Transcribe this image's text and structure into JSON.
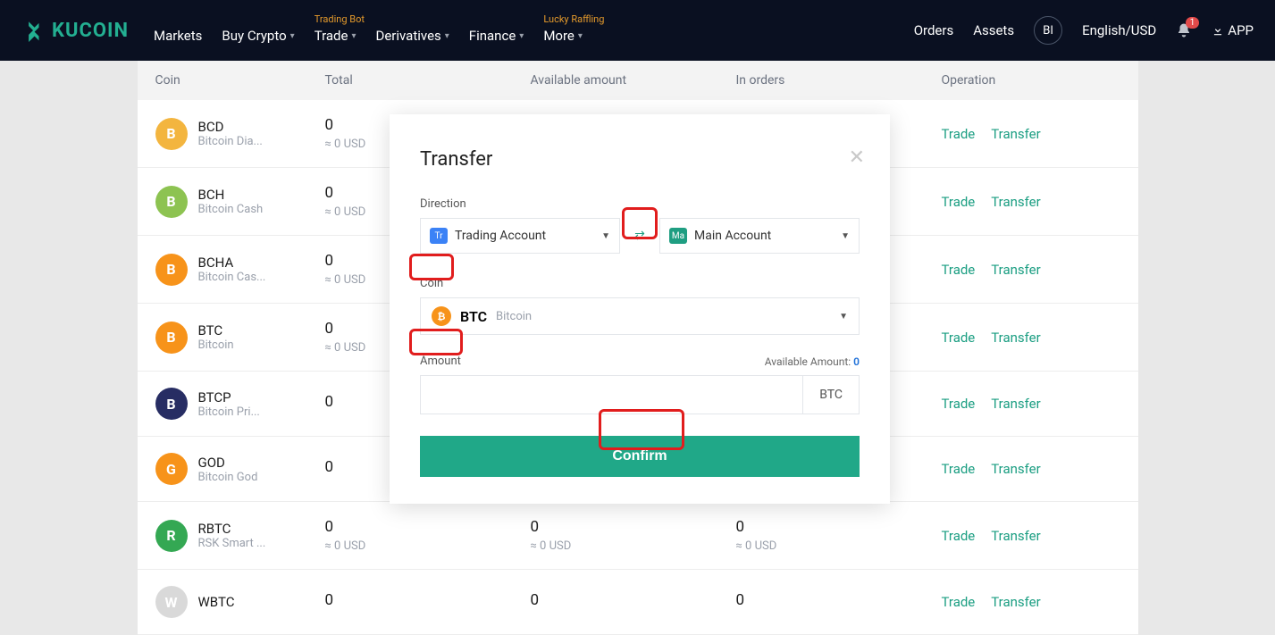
{
  "topbar": {
    "brand": "KUCOIN",
    "nav": [
      "Markets",
      "Buy Crypto",
      "Trade",
      "Derivatives",
      "Finance",
      "More"
    ],
    "nav_sup_trade": "Trading Bot",
    "nav_sup_more": "Lucky Raffling",
    "right": {
      "orders": "Orders",
      "assets": "Assets",
      "avatar": "BI",
      "lang": "English/USD",
      "notif_count": "1",
      "app": "APP"
    }
  },
  "table": {
    "headers": {
      "coin": "Coin",
      "total": "Total",
      "available": "Available amount",
      "in_orders": "In orders",
      "operation": "Operation"
    },
    "ops": {
      "trade": "Trade",
      "transfer": "Transfer"
    },
    "rows": [
      {
        "sym": "BCD",
        "name": "Bitcoin Dia...",
        "total": "0",
        "total_sub": "≈ 0 USD",
        "avail": "",
        "avail_sub": "",
        "orders": "",
        "orders_sub": "",
        "color": "#f3b53f"
      },
      {
        "sym": "BCH",
        "name": "Bitcoin Cash",
        "total": "0",
        "total_sub": "≈ 0 USD",
        "avail": "",
        "avail_sub": "",
        "orders": "",
        "orders_sub": "",
        "color": "#8dc351"
      },
      {
        "sym": "BCHA",
        "name": "Bitcoin Cas...",
        "total": "0",
        "total_sub": "≈ 0 USD",
        "avail": "",
        "avail_sub": "",
        "orders": "",
        "orders_sub": "",
        "color": "#f7931a"
      },
      {
        "sym": "BTC",
        "name": "Bitcoin",
        "total": "0",
        "total_sub": "≈ 0 USD",
        "avail": "",
        "avail_sub": "",
        "orders": "",
        "orders_sub": "",
        "color": "#f7931a"
      },
      {
        "sym": "BTCP",
        "name": "Bitcoin Pri...",
        "total": "0",
        "total_sub": "",
        "avail": "",
        "avail_sub": "",
        "orders": "",
        "orders_sub": "",
        "color": "#272d63"
      },
      {
        "sym": "GOD",
        "name": "Bitcoin God",
        "total": "0",
        "total_sub": "",
        "avail": "",
        "avail_sub": "",
        "orders": "",
        "orders_sub": "",
        "color": "#f7931a"
      },
      {
        "sym": "RBTC",
        "name": "RSK Smart ...",
        "total": "0",
        "total_sub": "≈ 0 USD",
        "avail": "0",
        "avail_sub": "≈ 0 USD",
        "orders": "0",
        "orders_sub": "≈ 0 USD",
        "color": "#34a853"
      },
      {
        "sym": "WBTC",
        "name": "",
        "total": "0",
        "total_sub": "",
        "avail": "0",
        "avail_sub": "",
        "orders": "0",
        "orders_sub": "",
        "color": "#d9d9d9"
      }
    ]
  },
  "modal": {
    "title": "Transfer",
    "direction_label": "Direction",
    "from_tag": "Tr",
    "from_account": "Trading Account",
    "to_tag": "Ma",
    "to_account": "Main Account",
    "coin_label": "Coin",
    "coin_sym": "BTC",
    "coin_name": "Bitcoin",
    "amount_label": "Amount",
    "available_label": "Available Amount:",
    "available_value": "0",
    "unit": "BTC",
    "confirm": "Confirm"
  }
}
